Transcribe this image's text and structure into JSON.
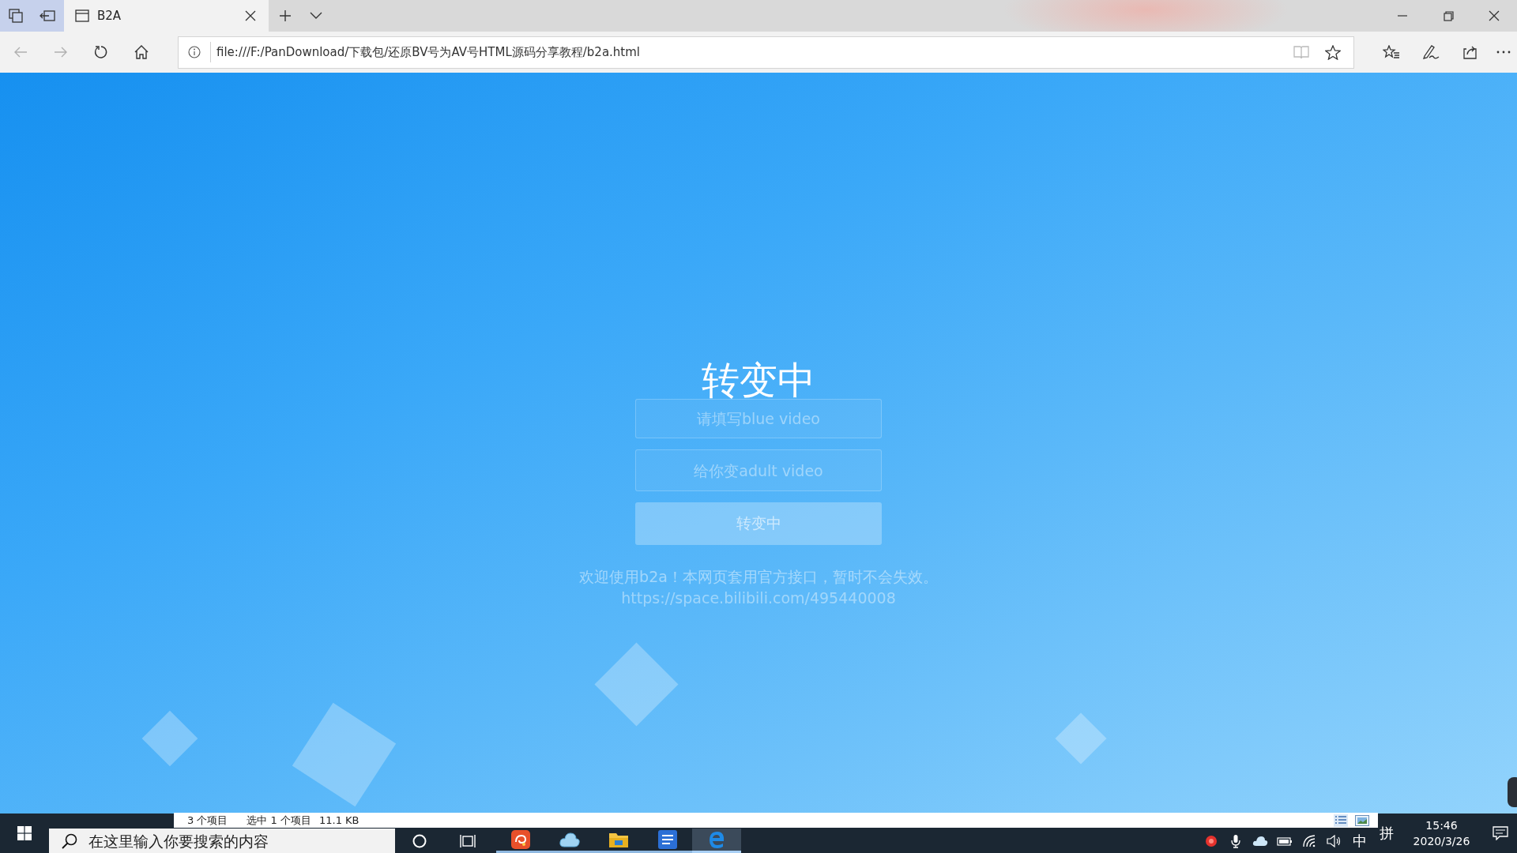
{
  "browser": {
    "tabs": [
      {
        "title": "B2A",
        "selected": true
      }
    ],
    "address": "file:///F:/PanDownload/下载包/还原BV号为AV号HTML源码分享教程/b2a.html"
  },
  "page": {
    "title": "转变中",
    "inputs": [
      {
        "placeholder": "请填写blue video"
      },
      {
        "placeholder": "给你变adult video"
      }
    ],
    "button": "转变中",
    "notice": "欢迎使用b2a！本网页套用官方接口，暂时不会失效。",
    "link": "https://space.bilibili.com/495440008"
  },
  "explorer_status": {
    "item_count": "3 个项目",
    "selection": "选中 1 个项目",
    "size": "11.1 KB"
  },
  "taskbar": {
    "search": {
      "placeholder": "在这里输入你要搜索的内容"
    },
    "apps": [
      {
        "kind": "swirl",
        "running": true,
        "selected": false
      },
      {
        "kind": "cloud",
        "running": true,
        "selected": false
      },
      {
        "kind": "folder",
        "running": true,
        "selected": false
      },
      {
        "kind": "document",
        "running": true,
        "selected": false
      },
      {
        "kind": "browser",
        "running": true,
        "selected": true
      }
    ],
    "input_mode": "中",
    "ime": "拼",
    "time": "15:46",
    "date": "2020/3/26"
  }
}
